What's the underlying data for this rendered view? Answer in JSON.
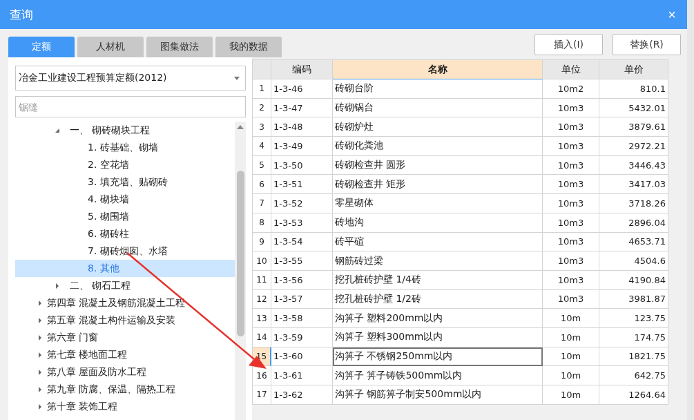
{
  "window": {
    "title": "查询",
    "close": "×"
  },
  "tabs": [
    {
      "label": "定额",
      "selected": true
    },
    {
      "label": "人材机",
      "selected": false
    },
    {
      "label": "图集做法",
      "selected": false
    },
    {
      "label": "我的数据",
      "selected": false
    }
  ],
  "buttons": [
    "插入(I)",
    "替换(R)"
  ],
  "quota_select": {
    "value": "冶金工业建设工程预算定额(2012)"
  },
  "search": {
    "placeholder": "锯缝"
  },
  "tree": {
    "continued_children": [
      {
        "label": "一、  砌砖砌块工程",
        "expanded": true,
        "selected": false,
        "children": [
          {
            "label": "1. 砖基础、砌墙",
            "selected": false
          },
          {
            "label": "2. 空花墙",
            "selected": false
          },
          {
            "label": "3. 填充墙、贴砌砖",
            "selected": false
          },
          {
            "label": "4. 砌块墙",
            "selected": false
          },
          {
            "label": "5. 砌围墙",
            "selected": false
          },
          {
            "label": "6. 砌砖柱",
            "selected": false
          },
          {
            "label": "7. 砌砖烟囱、水塔",
            "selected": false
          },
          {
            "label": "8. 其他",
            "selected": true
          }
        ]
      },
      {
        "label": "二、  砌石工程",
        "expanded": false,
        "selected": false
      }
    ],
    "items": [
      {
        "label": "第四章 混凝土及钢筋混凝土工程",
        "expanded": false,
        "selected": false
      },
      {
        "label": "第五章 混凝土构件运输及安装",
        "expanded": false,
        "selected": false
      },
      {
        "label": "第六章 门窗",
        "expanded": false,
        "selected": false
      },
      {
        "label": "第七章 楼地面工程",
        "expanded": false,
        "selected": false
      },
      {
        "label": "第八章 屋面及防水工程",
        "expanded": false,
        "selected": false
      },
      {
        "label": "第九章 防腐、保温、隔热工程",
        "expanded": false,
        "selected": false
      },
      {
        "label": "第十章 装饰工程",
        "expanded": false,
        "selected": false
      }
    ]
  },
  "table": {
    "columns": [
      {
        "label": "编码",
        "selected": false
      },
      {
        "label": "名称",
        "selected": true
      },
      {
        "label": "单位",
        "selected": false
      },
      {
        "label": "单价",
        "selected": false
      }
    ],
    "rows": [
      {
        "no": "1",
        "code": "1-3-46",
        "name": "砖砌台阶",
        "unit": "10m2",
        "price": "810.1",
        "selected": false
      },
      {
        "no": "2",
        "code": "1-3-47",
        "name": "砖砌锅台",
        "unit": "10m3",
        "price": "5432.01",
        "selected": false
      },
      {
        "no": "3",
        "code": "1-3-48",
        "name": "砖砌炉灶",
        "unit": "10m3",
        "price": "3879.61",
        "selected": false
      },
      {
        "no": "4",
        "code": "1-3-49",
        "name": "砖砌化粪池",
        "unit": "10m3",
        "price": "2972.21",
        "selected": false
      },
      {
        "no": "5",
        "code": "1-3-50",
        "name": "砖砌检查井 圆形",
        "unit": "10m3",
        "price": "3446.43",
        "selected": false
      },
      {
        "no": "6",
        "code": "1-3-51",
        "name": "砖砌检查井 矩形",
        "unit": "10m3",
        "price": "3417.03",
        "selected": false
      },
      {
        "no": "7",
        "code": "1-3-52",
        "name": "零星砌体",
        "unit": "10m3",
        "price": "3718.26",
        "selected": false
      },
      {
        "no": "8",
        "code": "1-3-53",
        "name": "砖地沟",
        "unit": "10m3",
        "price": "2896.04",
        "selected": false
      },
      {
        "no": "9",
        "code": "1-3-54",
        "name": "砖平碹",
        "unit": "10m3",
        "price": "4653.71",
        "selected": false
      },
      {
        "no": "10",
        "code": "1-3-55",
        "name": "钢筋砖过梁",
        "unit": "10m3",
        "price": "4504.6",
        "selected": false
      },
      {
        "no": "11",
        "code": "1-3-56",
        "name": "挖孔桩砖护壁 1/4砖",
        "unit": "10m3",
        "price": "4190.84",
        "selected": false
      },
      {
        "no": "12",
        "code": "1-3-57",
        "name": "挖孔桩砖护壁 1/2砖",
        "unit": "10m3",
        "price": "3981.87",
        "selected": false
      },
      {
        "no": "13",
        "code": "1-3-58",
        "name": "沟箅子 塑料200mm以内",
        "unit": "10m",
        "price": "123.75",
        "selected": false
      },
      {
        "no": "14",
        "code": "1-3-59",
        "name": "沟箅子 塑料300mm以内",
        "unit": "10m",
        "price": "174.75",
        "selected": false
      },
      {
        "no": "15",
        "code": "1-3-60",
        "name": "沟箅子 不锈钢250mm以内",
        "unit": "10m",
        "price": "1821.75",
        "selected": true
      },
      {
        "no": "16",
        "code": "1-3-61",
        "name": "沟箅子 箅子铸铁500mm以内",
        "unit": "10m",
        "price": "642.75",
        "selected": false
      },
      {
        "no": "17",
        "code": "1-3-62",
        "name": "沟箅子 钢筋箅子制安500mm以内",
        "unit": "10m",
        "price": "1264.64",
        "selected": false
      }
    ]
  }
}
